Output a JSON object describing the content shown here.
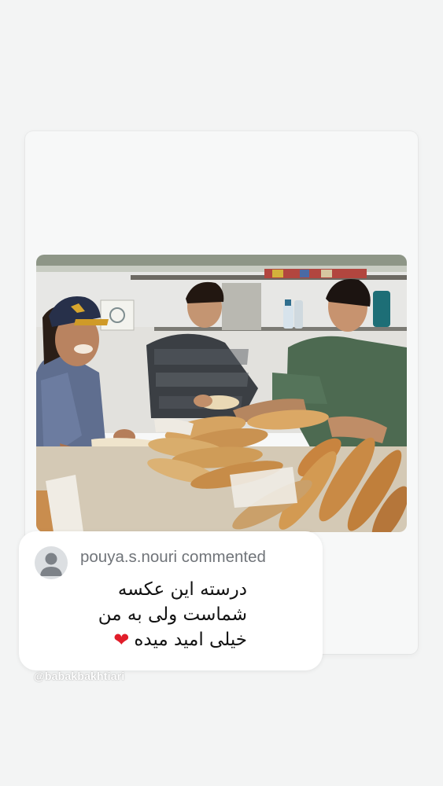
{
  "story": {
    "comment": {
      "username": "pouya.s.nouri",
      "action": "commented",
      "lines": [
        "درسته این عکسه",
        "شماست ولی به من",
        "خیلی امید میده"
      ],
      "emoji_icon": "red-heart-icon"
    },
    "watermark": "@babakbakhtiari"
  },
  "colors": {
    "background": "#f3f4f4",
    "bubble": "#ffffff",
    "username_text": "#707479",
    "comment_text": "#111111",
    "heart": "#e11d2a"
  }
}
